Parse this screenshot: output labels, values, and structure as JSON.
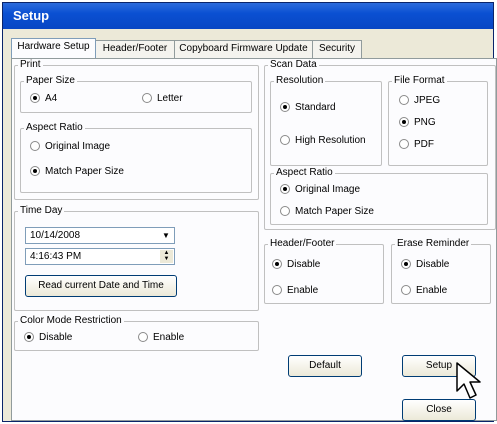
{
  "window": {
    "title": "Setup"
  },
  "tabs": [
    {
      "label": "Hardware Setup",
      "active": true
    },
    {
      "label": "Header/Footer"
    },
    {
      "label": "Copyboard Firmware Update"
    },
    {
      "label": "Security"
    }
  ],
  "print": {
    "legend": "Print",
    "paper_size": {
      "legend": "Paper Size",
      "a4": "A4",
      "letter": "Letter",
      "selected": "A4"
    },
    "aspect_ratio": {
      "legend": "Aspect Ratio",
      "original": "Original Image",
      "match": "Match Paper Size",
      "selected": "Match Paper Size"
    }
  },
  "time_day": {
    "legend": "Time Day",
    "date": "10/14/2008",
    "time": "4:16:43 PM",
    "read_button": "Read current Date and Time"
  },
  "color_mode": {
    "legend": "Color Mode Restriction",
    "disable": "Disable",
    "enable": "Enable",
    "selected": "Disable"
  },
  "scan_data": {
    "legend": "Scan Data",
    "resolution": {
      "legend": "Resolution",
      "standard": "Standard",
      "high": "High Resolution",
      "selected": "Standard"
    },
    "file_format": {
      "legend": "File Format",
      "jpeg": "JPEG",
      "png": "PNG",
      "pdf": "PDF",
      "selected": "PNG"
    },
    "aspect_ratio": {
      "legend": "Aspect Ratio",
      "original": "Original Image",
      "match": "Match Paper Size",
      "selected": "Original Image"
    }
  },
  "header_footer": {
    "legend": "Header/Footer",
    "disable": "Disable",
    "enable": "Enable",
    "selected": "Disable"
  },
  "erase_reminder": {
    "legend": "Erase Reminder",
    "disable": "Disable",
    "enable": "Enable",
    "selected": "Disable"
  },
  "buttons": {
    "default": "Default",
    "setup": "Setup",
    "close": "Close"
  }
}
